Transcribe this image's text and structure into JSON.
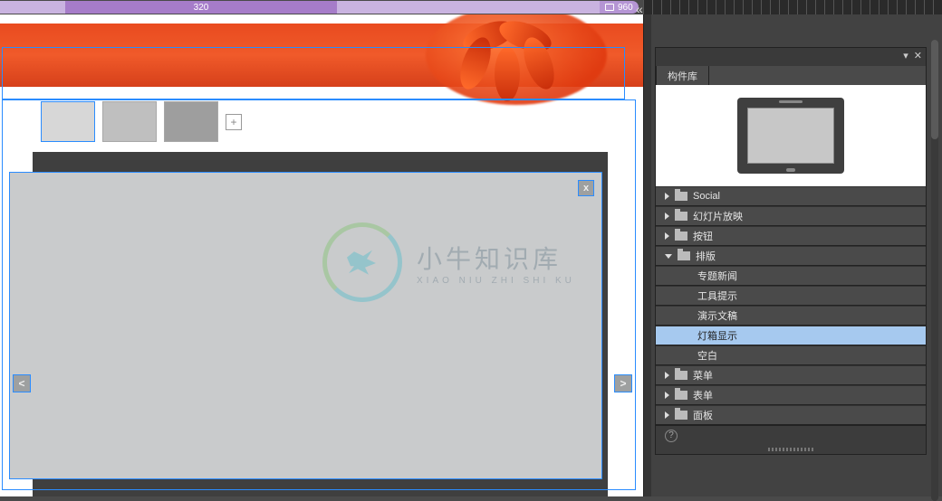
{
  "ruler": {
    "bp_small": "320",
    "bp_current": "960"
  },
  "panel": {
    "tab_title": "构件库"
  },
  "tree": {
    "social": "Social",
    "slideshow": "幻灯片放映",
    "button": "按钮",
    "layout": "排版",
    "layout_children": {
      "featured_news": "专题新闻",
      "tooltip": "工具提示",
      "presentation": "演示文稿",
      "lightbox": "灯箱显示",
      "blank": "空白"
    },
    "menu": "菜单",
    "form": "表单",
    "panel": "面板"
  },
  "nav": {
    "prev": "<",
    "next": ">",
    "close": "x"
  },
  "add": "+",
  "watermark": {
    "title": "小牛知识库",
    "sub": "XIAO NIU ZHI SHI KU"
  },
  "icons": {
    "help": "?",
    "collapse": "«",
    "minimize": "▾",
    "close": "✕"
  }
}
